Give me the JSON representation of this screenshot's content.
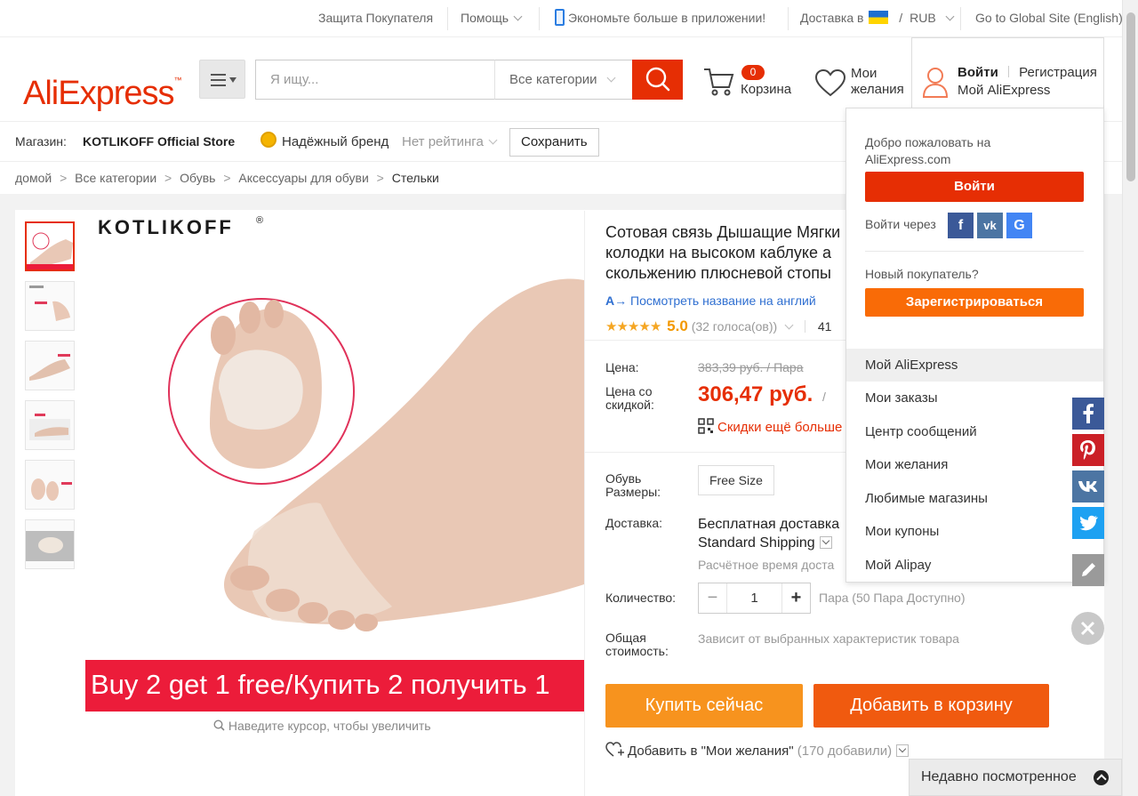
{
  "topbar": {
    "buyer_protection": "Защита Покупателя",
    "help": "Помощь",
    "app_promo": "Экономьте больше в приложении!",
    "ship_to": "Доставка в",
    "currency_sep": "/",
    "currency": "RUB",
    "global_site": "Go to Global Site (English)"
  },
  "header": {
    "logo_text": "AliExpress",
    "logo_tm": "™",
    "search_placeholder": "Я ищу...",
    "search_category": "Все категории",
    "cart_count": "0",
    "cart_label": "Корзина",
    "wishlist_line1": "Мои",
    "wishlist_line2": "желания",
    "login": "Войти",
    "register": "Регистрация",
    "my_aliexpress": "Мой AliExpress"
  },
  "store": {
    "label": "Магазин:",
    "name": "KOTLIKOFF Official Store",
    "badge": "Надёжный бренд",
    "rating": "Нет рейтинга",
    "save": "Сохранить"
  },
  "breadcrumb": {
    "items": [
      "домой",
      "Все категории",
      "Обувь",
      "Аксессуары для обуви",
      "Стельки"
    ],
    "sep": ">"
  },
  "gallery": {
    "brand": "KOTLIKOFF",
    "brand_reg": "®",
    "promo_banner": "Buy 2 get 1 free/Купить 2 получить 1",
    "zoom_hint": "Наведите курсор, чтобы увеличить"
  },
  "product": {
    "title_line1": "Сотовая связь Дышащие Мягки",
    "title_line2": "колодки на высоком каблуке а",
    "title_line3": "скольжению плюсневой стопы",
    "translate": "Посмотреть название на англий",
    "rating_value": "5.0",
    "votes": "(32 голоса(ов))",
    "orders_partial": "41",
    "price_label": "Цена:",
    "old_price": "383,39 руб. / Пара",
    "discount_label_1": "Цена со",
    "discount_label_2": "скидкой:",
    "new_price": "306,47 руб.",
    "new_price_unit": "/",
    "coupon_more": "Скидки ещё больше",
    "size_label_1": "Обувь",
    "size_label_2": "Размеры:",
    "size_value": "Free Size",
    "shipping_label": "Доставка:",
    "shipping_main": "Бесплатная доставка",
    "shipping_service": "Standard Shipping",
    "shipping_est": "Расчётное время доста",
    "qty_label": "Количество:",
    "qty_minus": "−",
    "qty_value": "1",
    "qty_plus": "+",
    "qty_note": "Пара (50 Пара Доступно)",
    "total_label_1": "Общая",
    "total_label_2": "стоимость:",
    "total_note": "Зависит от выбранных характеристик товара",
    "buy_now": "Купить сейчас",
    "add_to_cart": "Добавить в корзину",
    "add_wish": "Добавить в \"Мои желания\"",
    "wish_count": "(170 добавили)"
  },
  "dropdown": {
    "welcome_1": "Добро пожаловать на",
    "welcome_2": "AliExpress.com",
    "login_btn": "Войти",
    "login_via": "Войти через",
    "social": [
      "f",
      "vk",
      "G"
    ],
    "new_buyer": "Новый покупатель?",
    "register_btn": "Зарегистрироваться",
    "menu": [
      "Мой AliExpress",
      "Мои заказы",
      "Центр сообщений",
      "Мои желания",
      "Любимые магазины",
      "Мои купоны",
      "Мой Alipay"
    ]
  },
  "share": {
    "icons": [
      "facebook-icon",
      "pinterest-icon",
      "vk-icon",
      "twitter-icon",
      "edit-icon"
    ]
  },
  "recent": {
    "label": "Недавно посмотренное"
  },
  "colors": {
    "brand": "#e62e04",
    "buy_now": "#f7931e",
    "add_to_cart": "#f05a0f",
    "register": "#f96b07",
    "facebook": "#3b5998",
    "pinterest": "#cb2027",
    "vk": "#4c75a3",
    "twitter": "#1da1f2",
    "google": "#4285f4"
  }
}
